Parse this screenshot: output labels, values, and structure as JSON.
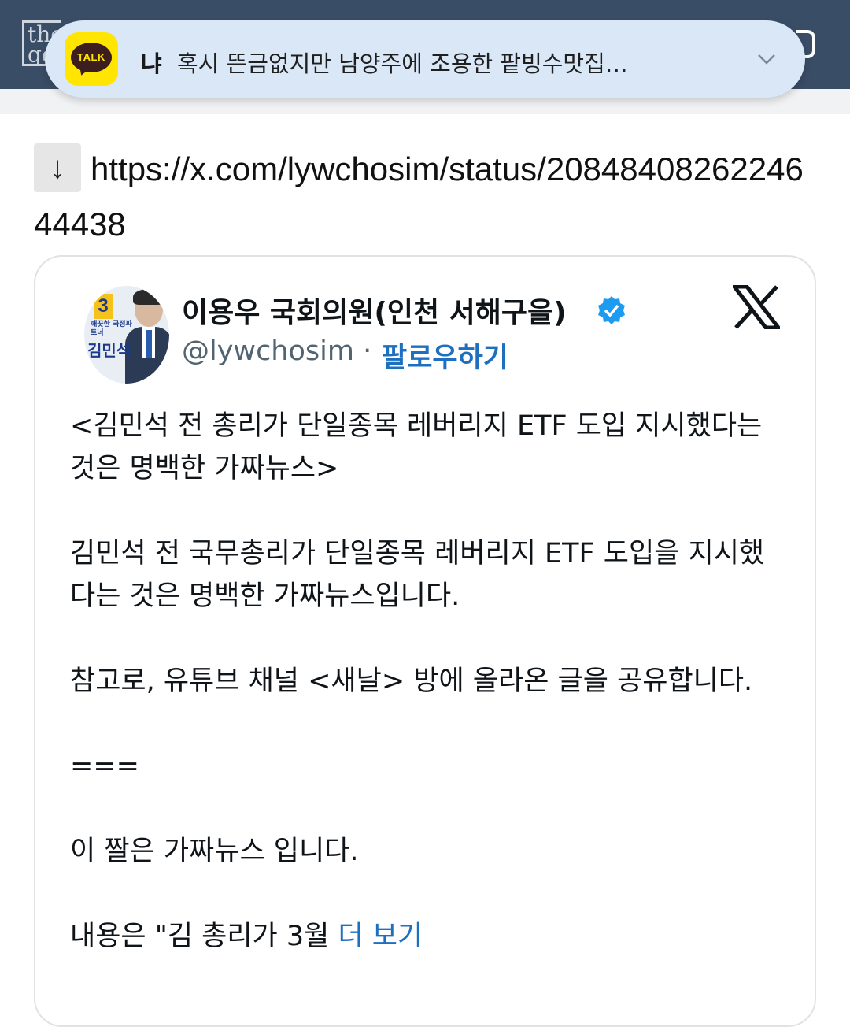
{
  "app_bar": {
    "logo_fragment": "the go"
  },
  "notification": {
    "app_icon": "kakaotalk-icon",
    "icon_label": "TALK",
    "sender": "냐",
    "message": "혹시 뜬금없지만 남양주에 조용한 팥빙수맛집 카...",
    "expand_icon": "chevron-down-icon"
  },
  "link": {
    "arrow": "↓",
    "url": "https://x.com/lywchosim/status/2084840826224644438"
  },
  "tweet": {
    "avatar": {
      "number": "3",
      "small_text": "깨끗한 국정파트너",
      "name": "김민석"
    },
    "author_name": "이용우 국회의원(인천 서해구을)",
    "verified_icon": "verified-badge-icon",
    "handle": "@lywchosim",
    "separator": "·",
    "follow_label": "팔로우하기",
    "platform_icon": "x-logo-icon",
    "paragraphs": [
      "<김민석 전 총리가 단일종목 레버리지 ETF 도입 지시했다는 것은 명백한 가짜뉴스>",
      "김민석 전 국무총리가 단일종목 레버리지 ETF 도입을 지시했다는 것은 명백한 가짜뉴스입니다.",
      "참고로, 유튜브 채널 <새날> 방에 올라온 글을 공유합니다.",
      "===",
      "이 짤은 가짜뉴스 입니다."
    ],
    "last_line": "내용은 \"김 총리가 3월",
    "more_label": "더 보기"
  },
  "colors": {
    "app_bar": "#3a4d66",
    "notification_bg": "#d9e7f7",
    "kakao_yellow": "#ffe500",
    "link_blue": "#1d6fc0",
    "verified_blue": "#1d9bf0"
  }
}
